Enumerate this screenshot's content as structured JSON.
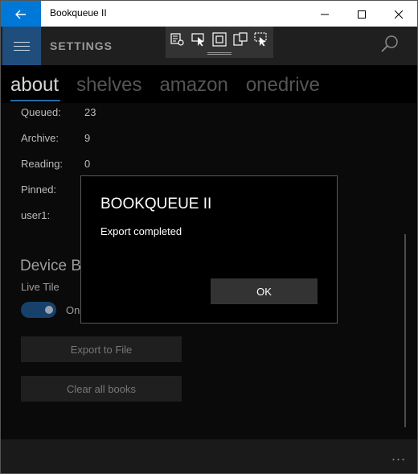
{
  "window": {
    "title": "Bookqueue II",
    "accent": "#0078d7"
  },
  "appbar": {
    "title": "SETTINGS"
  },
  "pivot": {
    "items": [
      "about",
      "shelves",
      "amazon",
      "onedrive"
    ],
    "active": "about"
  },
  "stats": [
    {
      "label": "Queued:",
      "value": "23"
    },
    {
      "label": "Archive:",
      "value": "9"
    },
    {
      "label": "Reading:",
      "value": "0"
    },
    {
      "label": "Pinned:",
      "value": ""
    },
    {
      "label": "user1:",
      "value": ""
    }
  ],
  "device": {
    "section_title": "Device Backup",
    "live_tile_label": "Live Tile",
    "toggle_state": "On",
    "export_label": "Export to File",
    "clear_label": "Clear all books"
  },
  "dialog": {
    "title": "BOOKQUEUE II",
    "message": "Export completed",
    "ok_label": "OK"
  },
  "bottombar": {
    "more": "..."
  }
}
